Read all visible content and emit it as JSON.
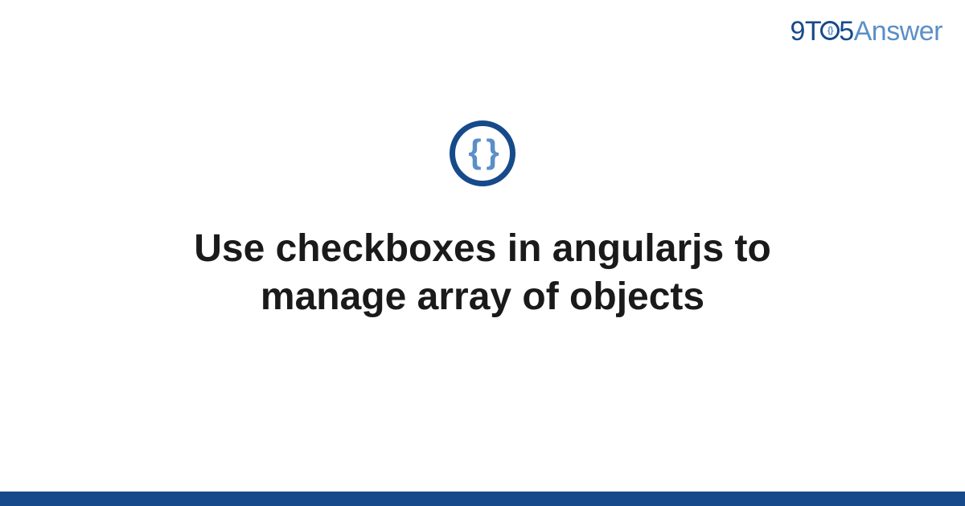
{
  "logo": {
    "part1": "9T",
    "part2": "5",
    "part3": "Answer"
  },
  "icon": {
    "name": "curly-braces-icon",
    "glyph": "{ }"
  },
  "title": "Use checkboxes in angularjs to manage array of objects",
  "colors": {
    "primary": "#164a8a",
    "secondary": "#5a8fc7"
  }
}
